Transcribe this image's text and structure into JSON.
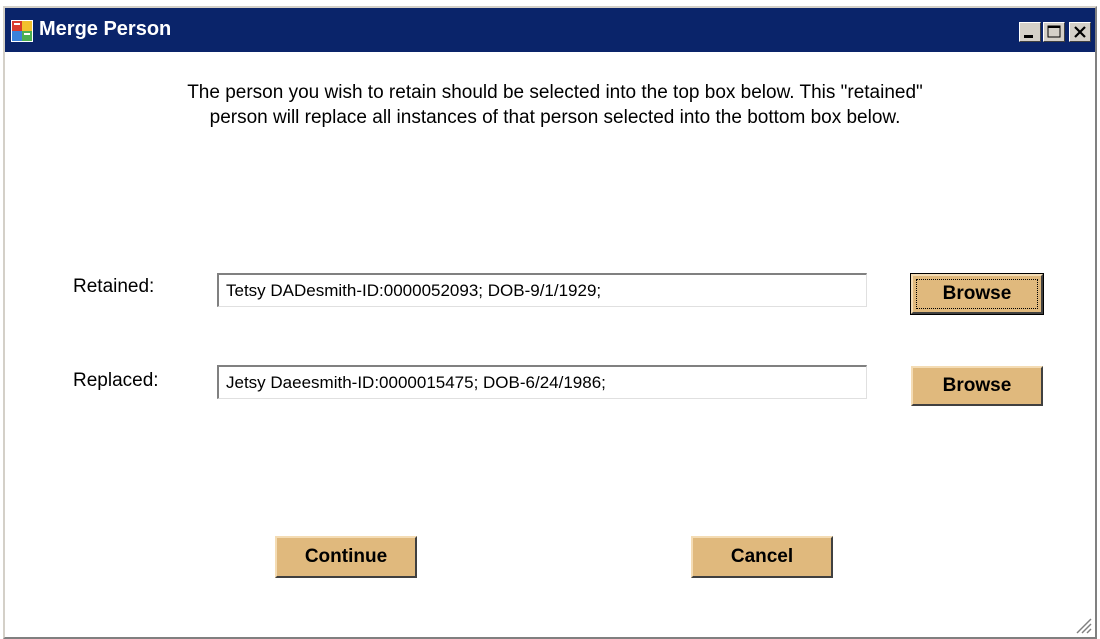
{
  "window": {
    "title": "Merge Person",
    "app_icon": "app-window-icon",
    "controls": {
      "minimize_icon": "minimize-icon",
      "maximize_icon": "maximize-icon",
      "close_icon": "close-icon"
    }
  },
  "instructions": {
    "line1": "The person you wish to retain should be selected into the top box below.  This \"retained\"",
    "line2": "person will replace all instances of that person selected into the bottom box below."
  },
  "retained": {
    "label": "Retained:",
    "value": "Tetsy DADesmith-ID:0000052093; DOB-9/1/1929;",
    "browse_label": "Browse"
  },
  "replaced": {
    "label": "Replaced:",
    "value": "Jetsy Daeesmith-ID:0000015475; DOB-6/24/1986;",
    "browse_label": "Browse"
  },
  "actions": {
    "continue_label": "Continue",
    "cancel_label": "Cancel"
  },
  "colors": {
    "titlebar": "#0a246a",
    "button_face": "#e0b97d",
    "window_chrome": "#d4d0c8"
  }
}
